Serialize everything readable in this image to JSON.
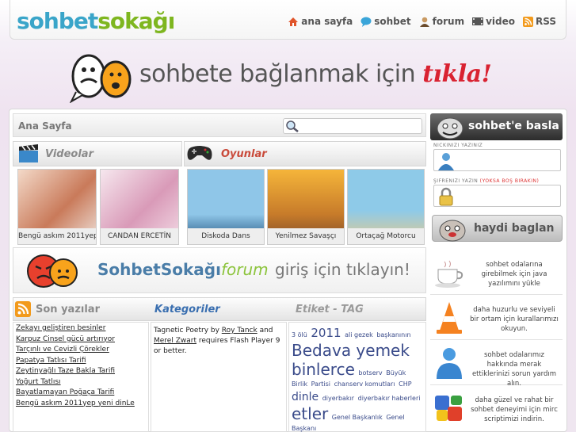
{
  "header": {
    "logo_part1": "sohbet",
    "logo_part2": "sokağı",
    "nav": [
      {
        "label": "ana sayfa",
        "icon": "home-icon",
        "color": "#e0542a"
      },
      {
        "label": "sohbet",
        "icon": "chat-bubble-icon",
        "color": "#3aa5d9"
      },
      {
        "label": "forum",
        "icon": "user-icon",
        "color": "#8c6a3c"
      },
      {
        "label": "video",
        "icon": "film-icon",
        "color": "#555555"
      },
      {
        "label": "RSS",
        "icon": "rss-icon",
        "color": "#f29a1c"
      }
    ]
  },
  "banner": {
    "text": "sohbete bağlanmak için",
    "highlight": "tıkla!"
  },
  "breadcrumb": "Ana Sayfa",
  "search": {
    "placeholder": ""
  },
  "videolar": {
    "title": "Videolar",
    "items": [
      {
        "caption": "Bengü askım 2011yep"
      },
      {
        "caption": "CANDAN ERCETİN"
      }
    ]
  },
  "oyunlar": {
    "title": "Oyunlar",
    "items": [
      {
        "caption": "Diskoda Dans"
      },
      {
        "caption": "Yenilmez Savaşçı"
      },
      {
        "caption": "Ortaçağ Motorcu"
      }
    ]
  },
  "forum_banner": {
    "brand": "SohbetSokağı",
    "brand_suffix": "forum",
    "cta": "giriş için tıklayın!"
  },
  "son_yazilar": {
    "title": "Son yazılar",
    "items": [
      "Zekayı geliştiren besinler",
      "Karpuz Cinsel gücü artırıyor",
      "Tarçınlı ve Cevizli Çörekler",
      "Papatya Tatlısı Tarifi",
      "Zeytinyağlı Taze Bakla Tarifi",
      "Yoğurt Tatlısı",
      "Bayatlamayan Poğaça Tarifi",
      "Bengü askım 2011yep yeni dinLe"
    ]
  },
  "kategoriler": {
    "title": "Kategoriler",
    "text_pre": "Tagnetic Poetry by ",
    "link1": "Roy Tanck",
    "text_mid": " and ",
    "link2": "Merel Zwart",
    "text_post": " requires Flash Player 9 or better."
  },
  "etiket": {
    "title": "Etiket - TAG",
    "tags": [
      {
        "t": "3 ölü",
        "s": 8
      },
      {
        "t": "2011",
        "s": 15
      },
      {
        "t": "ali gezek",
        "s": 8
      },
      {
        "t": "başkanının",
        "s": 8
      },
      {
        "t": "Bedava yemek",
        "s": 20
      },
      {
        "t": "binlerce",
        "s": 20
      },
      {
        "t": "botserv",
        "s": 8
      },
      {
        "t": "Büyük Birlik",
        "s": 8
      },
      {
        "t": "Partisi",
        "s": 8
      },
      {
        "t": "chanserv komutları",
        "s": 8
      },
      {
        "t": "CHP",
        "s": 8
      },
      {
        "t": "dinle",
        "s": 14
      },
      {
        "t": "diyerbakır",
        "s": 8
      },
      {
        "t": "diyerbakır haberleri",
        "s": 8
      },
      {
        "t": "etler",
        "s": 20
      },
      {
        "t": "Genel Başkanlık",
        "s": 8
      },
      {
        "t": "Genel Başkanı",
        "s": 8
      }
    ]
  },
  "sidebar": {
    "head": "sohbet'e basla",
    "nick_label": "NICKINIZI YAZINIZ",
    "pass_label": "ŞIFRENIZI YAZIN",
    "pass_note": "(YOKSA BOŞ BIRAKIN)",
    "connect_label": "haydi baglan",
    "items": [
      {
        "icon": "teacup-icon",
        "text": "sohbet odalarına girebilmek için java yazılımını yükle"
      },
      {
        "icon": "traffic-cone-icon",
        "text": "daha huzurlu ve seviyeli bir ortam için kurallarımızı okuyun."
      },
      {
        "icon": "messenger-icon",
        "text": "sohbet odalarımız hakkında merak ettiklerinizi sorun yardım alın."
      },
      {
        "icon": "mirc-icon",
        "text": "daha güzel ve rahat bir sohbet deneyimi için mirc scriptimizi indirin."
      }
    ]
  }
}
